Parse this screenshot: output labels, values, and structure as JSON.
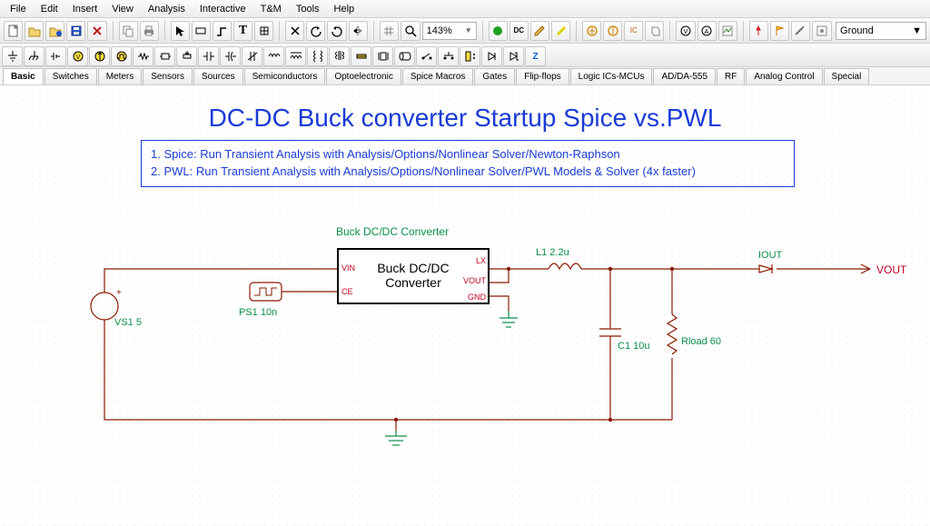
{
  "menu": {
    "items": [
      "File",
      "Edit",
      "Insert",
      "View",
      "Analysis",
      "Interactive",
      "T&M",
      "Tools",
      "Help"
    ]
  },
  "toolbar": {
    "zoom_value": "143%",
    "ground_label": "Ground"
  },
  "palette_tabs": [
    "Basic",
    "Switches",
    "Meters",
    "Sensors",
    "Sources",
    "Semiconductors",
    "Optoelectronic",
    "Spice Macros",
    "Gates",
    "Flip-flops",
    "Logic ICs-MCUs",
    "AD/DA-555",
    "RF",
    "Analog Control",
    "Special"
  ],
  "active_tab": 0,
  "schematic": {
    "title": "DC-DC Buck converter Startup Spice vs.PWL",
    "notes": [
      "1. Spice: Run Transient Analysis with Analysis/Options/Nonlinear Solver/Newton-Raphson",
      "2. PWL: Run Transient Analysis with Analysis/Options/Nonlinear Solver/PWL Models & Solver (4x faster)"
    ],
    "block_title": "Buck DC/DC Converter",
    "block_inner": "Buck DC/DC Converter",
    "pins": {
      "vin": "VIN",
      "ce": "CE",
      "lx": "LX",
      "vout": "VOUT",
      "gnd": "GND"
    },
    "labels": {
      "vs1": "VS1 5",
      "ps1": "PS1 10n",
      "l1": "L1 2.2u",
      "c1": "C1 10u",
      "rload": "Rload 60",
      "iout": "IOUT",
      "vout": "VOUT"
    },
    "colors": {
      "wire": "#8b1a00",
      "label_green": "#0a8f4a",
      "pin_red": "#c00020",
      "blue": "#1a3bd6"
    }
  }
}
